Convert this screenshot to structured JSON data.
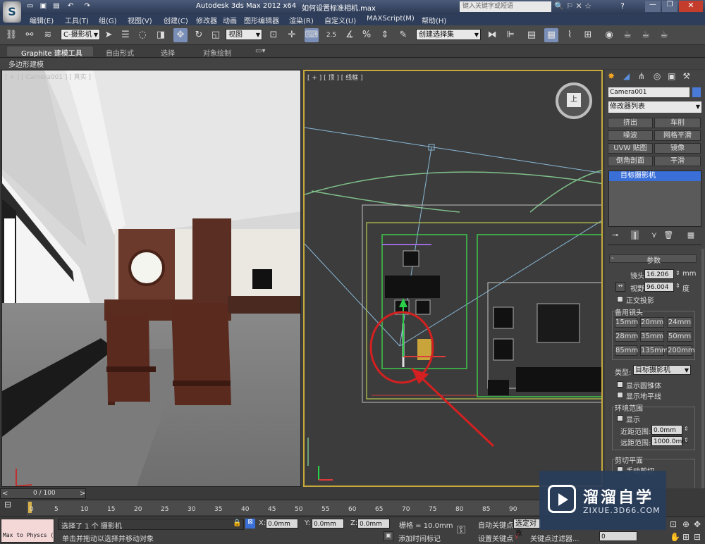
{
  "window": {
    "app_title": "Autodesk 3ds Max  2012 x64",
    "file_title": "如何设置标准相机.max",
    "search_placeholder": "键入关键字或短语"
  },
  "menu": [
    "编辑(E)",
    "工具(T)",
    "组(G)",
    "视图(V)",
    "创建(C)",
    "修改器",
    "动画",
    "图形编辑器",
    "渲染(R)",
    "自定义(U)",
    "MAXScript(M)",
    "帮助(H)"
  ],
  "toolbar": {
    "filter_value": "C-摄影机",
    "coord_value": "视图",
    "snap_angle": "2.5",
    "snap_pct": "%",
    "selection_set": "创建选择集"
  },
  "ribbon": {
    "tabs": [
      "Graphite 建模工具",
      "自由形式",
      "选择",
      "对象绘制"
    ],
    "sub_label": "多边形建模"
  },
  "viewport_left": {
    "label": "[ + ] [ Camera001 ] [ 真实 ]"
  },
  "viewport_right": {
    "label": "[ + ] [ 顶 ] [ 线框 ]",
    "compass": "上"
  },
  "command_panel": {
    "object_name": "Camera001",
    "modifier_list": "修改器列表",
    "modifier_buttons": [
      "挤出",
      "车削",
      "噪波",
      "网格平滑",
      "UVW 贴图",
      "镜像",
      "倒角剖面",
      "平滑"
    ],
    "stack_item": "目标摄影机",
    "rollout_title": "参数",
    "lens_label": "镜头:",
    "lens_value": "16.206",
    "lens_unit": "mm",
    "fov_label": "视野:",
    "fov_value": "96.004",
    "fov_unit": "度",
    "ortho_label": "正交投影",
    "stock_title": "备用镜头",
    "stock_lenses": [
      "15mm",
      "20mm",
      "24mm",
      "28mm",
      "35mm",
      "50mm",
      "85mm",
      "135mm",
      "200mm"
    ],
    "type_label": "类型:",
    "type_value": "目标摄影机",
    "show_cone": "显示圆锥体",
    "show_horizon": "显示地平线",
    "env_title": "环境范围",
    "env_show": "显示",
    "near_label": "近距范围:",
    "near_value": "0.0mm",
    "far_label": "远距范围:",
    "far_value": "1000.0mm",
    "clip_title": "剪切平面",
    "clip_manual": "手动剪切"
  },
  "timeline": {
    "frame_display": "0 / 100",
    "ticks": [
      "0",
      "5",
      "10",
      "15",
      "20",
      "25",
      "30",
      "35",
      "40",
      "45",
      "50",
      "55",
      "60",
      "65",
      "70",
      "75",
      "80",
      "85",
      "90"
    ]
  },
  "status": {
    "script_label": "Max to Physcs (",
    "selected_msg": "选择了 1 个 摄影机",
    "hint_msg": "单击并拖动以选择并移动对象",
    "x_label": "X:",
    "x_value": "0.0mm",
    "y_label": "Y:",
    "y_value": "0.0mm",
    "z_label": "Z:",
    "z_value": "0.0mm",
    "grid_label": "栅格 = 10.0mm",
    "add_tag": "添加时间标记",
    "auto_key": "自动关键点",
    "set_key": "设置关键点",
    "selected_obj": "选定对象",
    "key_filters": "关键点过滤器...",
    "frame_value": "0"
  },
  "watermark": {
    "title": "溜溜自学",
    "url": "ZIXUE.3D66.COM"
  },
  "colors": {
    "accent_yellow": "#c7a93b",
    "selection_red": "#d42020",
    "stack_blue": "#3a6fd8"
  }
}
